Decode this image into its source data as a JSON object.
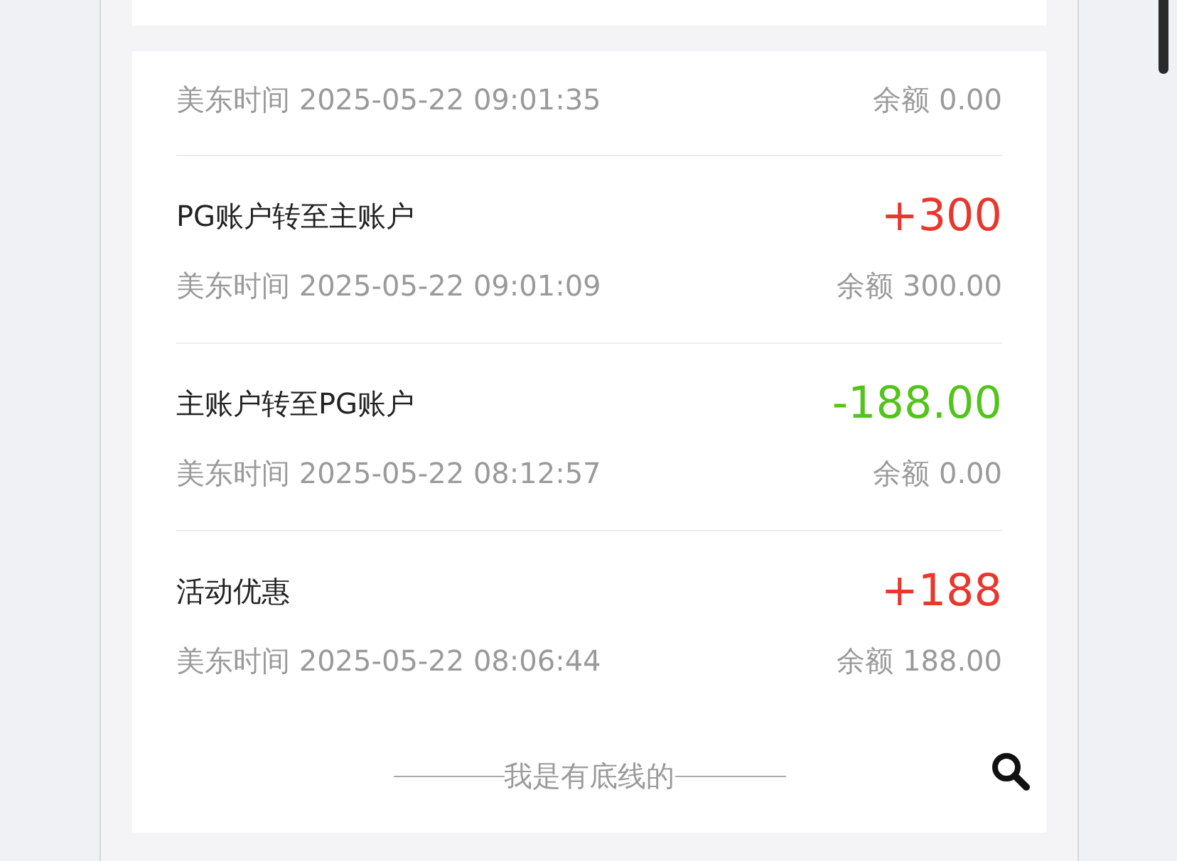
{
  "records": [
    {
      "kind": "partial",
      "time": "美东时间 2025-05-22 09:01:35",
      "balance": "余额 0.00"
    },
    {
      "kind": "in",
      "title": "PG账户转至主账户",
      "amount": "+300",
      "time": "美东时间 2025-05-22 09:01:09",
      "balance": "余额 300.00"
    },
    {
      "kind": "out",
      "title": "主账户转至PG账户",
      "amount": "-188.00",
      "time": "美东时间 2025-05-22 08:12:57",
      "balance": "余额 0.00"
    },
    {
      "kind": "in",
      "title": "活动优惠",
      "amount": "+188",
      "time": "美东时间 2025-05-22 08:06:44",
      "balance": "余额 188.00"
    }
  ],
  "footer": "我是有底线的"
}
